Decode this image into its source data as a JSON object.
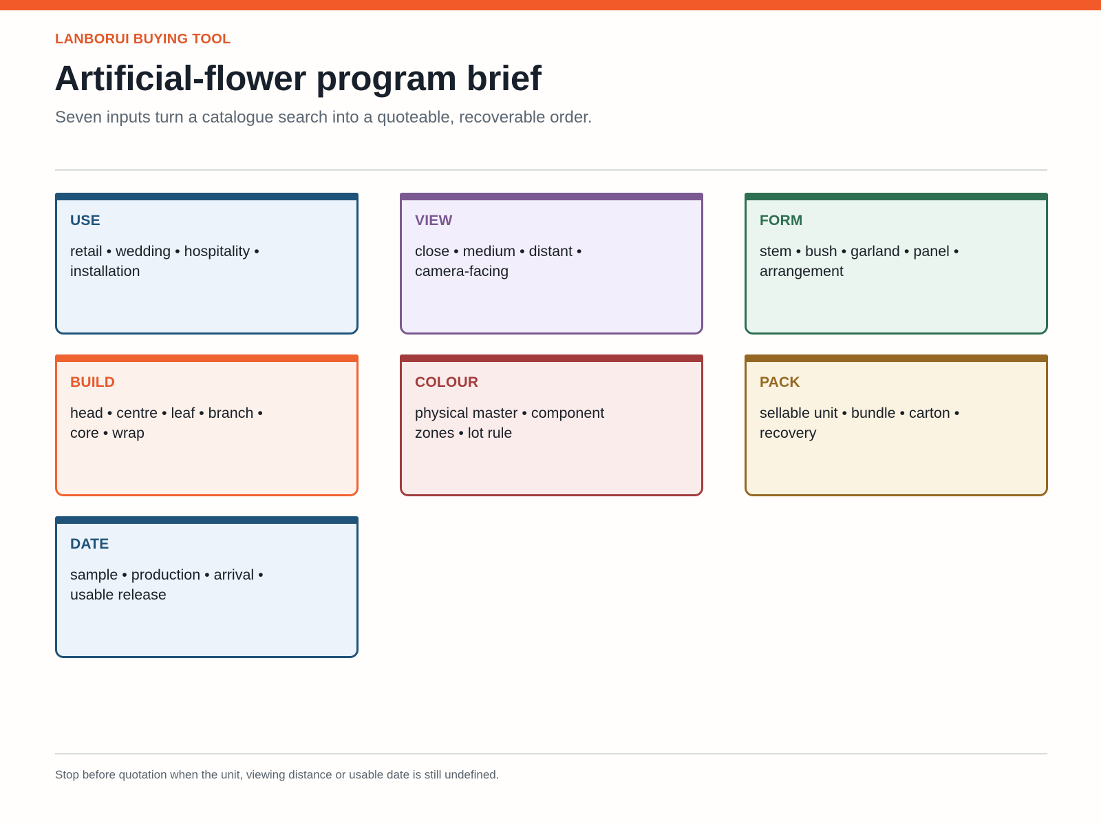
{
  "header": {
    "eyebrow": "LANBORUI BUYING TOOL",
    "title": "Artificial-flower program brief",
    "subtitle": "Seven inputs turn a catalogue search into a quoteable, recoverable order."
  },
  "cards": [
    {
      "title": "USE",
      "body": "retail • wedding • hospitality • installation",
      "color": "#1f5379"
    },
    {
      "title": "VIEW",
      "body": "close • medium • distant • camera-facing",
      "color": "#7a5891"
    },
    {
      "title": "FORM",
      "body": "stem • bush • garland • panel • arrangement",
      "color": "#2e6f51"
    },
    {
      "title": "BUILD",
      "body": "head • centre • leaf • branch • core • wrap",
      "color": "#ef6330"
    },
    {
      "title": "COLOUR",
      "body": "physical master • component zones • lot rule",
      "color": "#a23c3c"
    },
    {
      "title": "PACK",
      "body": "sellable unit • bundle • carton • recovery",
      "color": "#946823"
    },
    {
      "title": "DATE",
      "body": "sample • production • arrival • usable release",
      "color": "#1f5379"
    }
  ],
  "footer": {
    "note": "Stop before quotation when the unit, viewing distance or usable date is still undefined."
  },
  "colors": {
    "accent": "#f25a29",
    "title_text": "#17202b",
    "muted_text": "#5b6672"
  }
}
